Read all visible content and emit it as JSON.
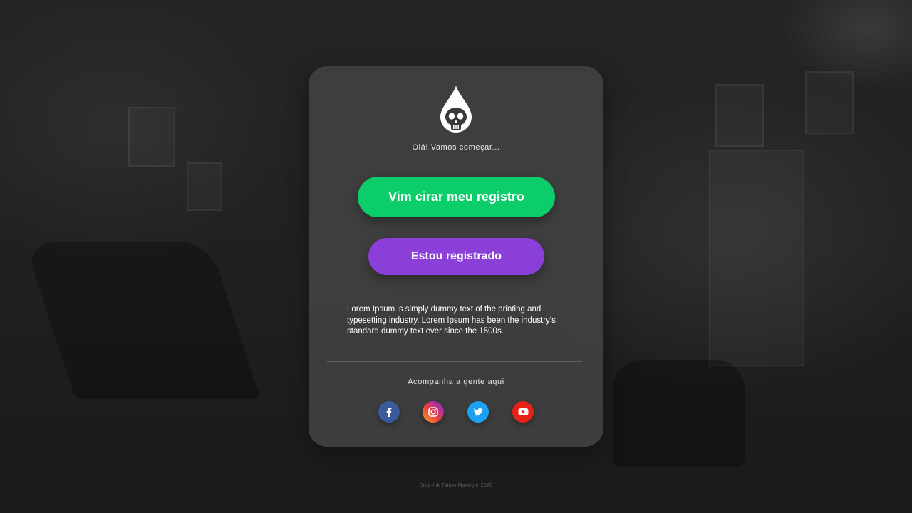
{
  "card": {
    "greeting": "Olá! Vamos começar...",
    "register_button": "Vim cirar meu registro",
    "login_button": "Estou registrado",
    "description": "Lorem Ipsum is simply dummy text of the printing and typesetting industry. Lorem Ipsum has been the industry's standard dummy text ever since the 1500s.",
    "follow_label": "Acompanha a gente aqui",
    "social": [
      {
        "icon": "facebook-icon",
        "color": "#3b5a9a"
      },
      {
        "icon": "instagram-icon",
        "color": "#c13584"
      },
      {
        "icon": "twitter-icon",
        "color": "#1da1f2"
      },
      {
        "icon": "youtube-icon",
        "color": "#e62117"
      }
    ]
  },
  "footer": {
    "text": "Drop Ink Tattoo Maneger 2020"
  },
  "colors": {
    "accent_green": "#0bce6b",
    "accent_purple": "#8a3fd9",
    "card_bg": "#464646"
  }
}
